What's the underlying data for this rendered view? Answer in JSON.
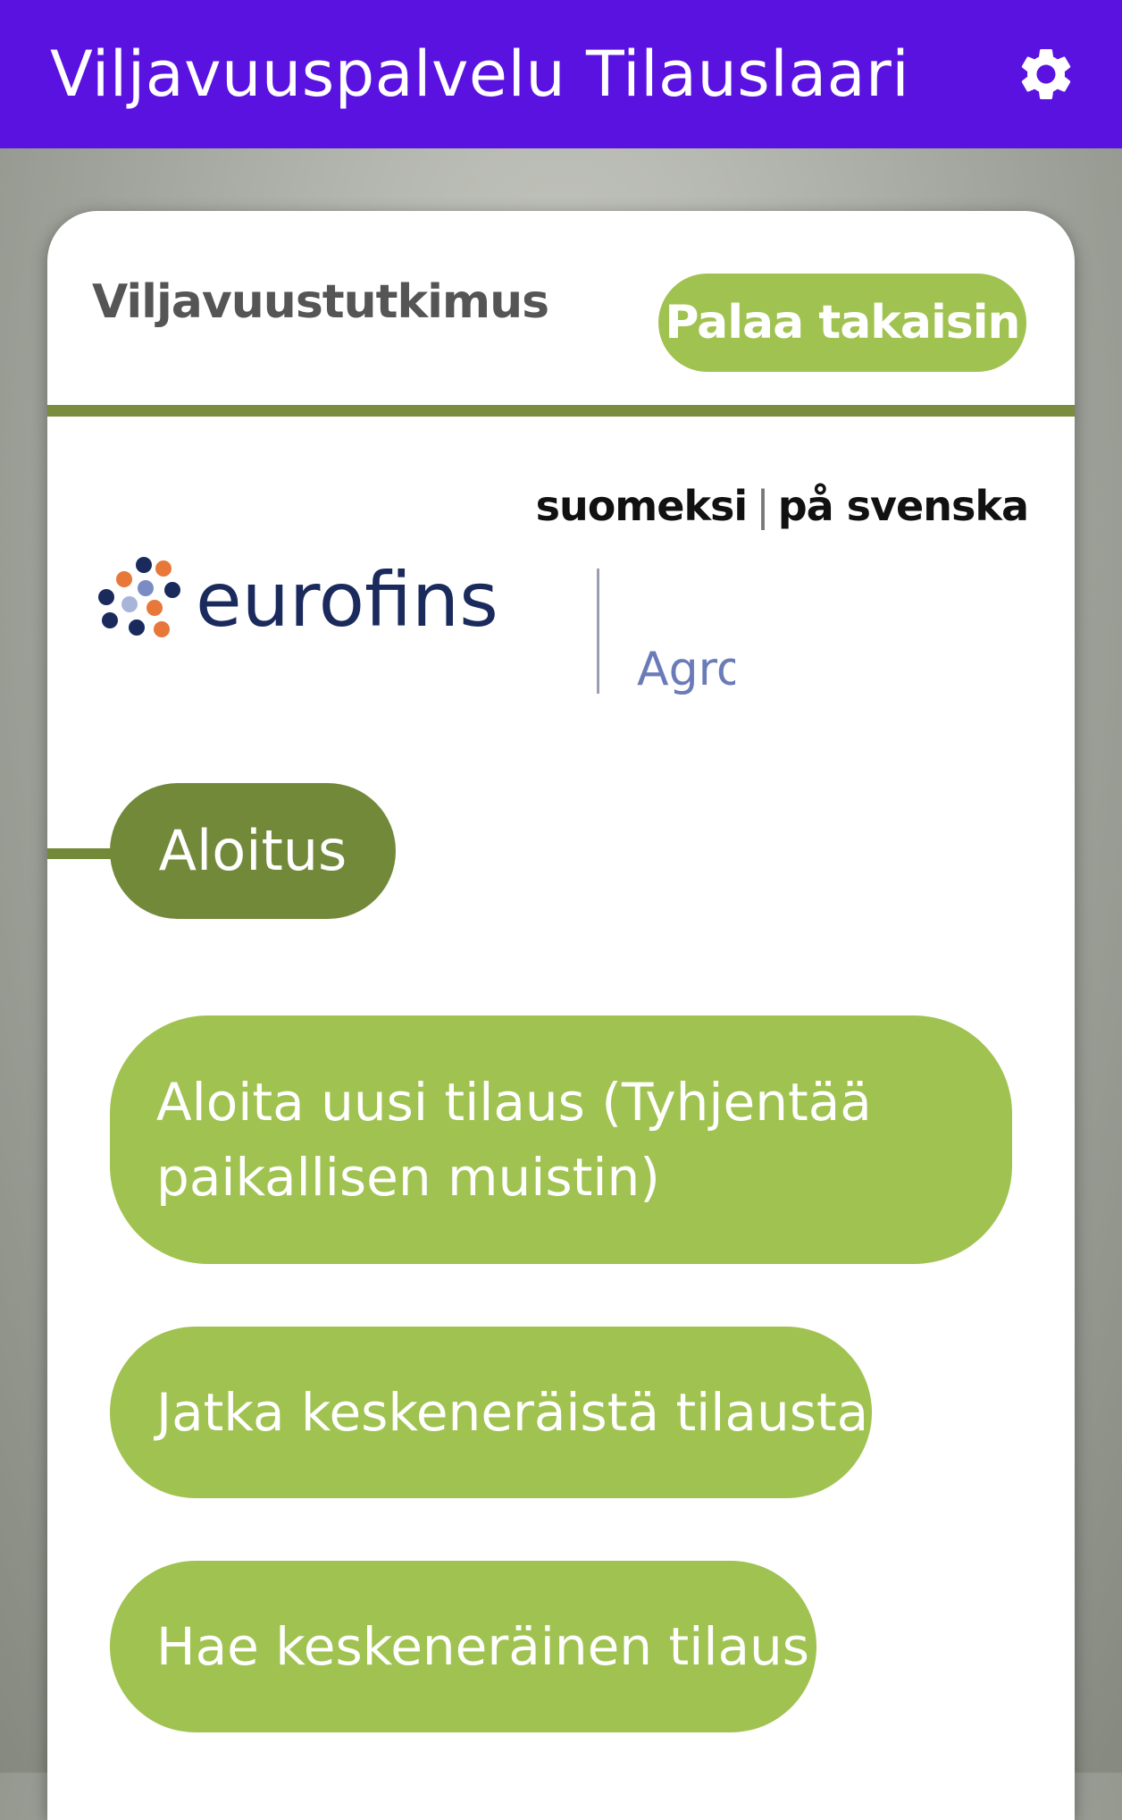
{
  "appbar": {
    "title": "Viljavuuspalvelu Tilauslaari",
    "settings_icon": "gear-icon"
  },
  "card": {
    "title": "Viljavuustutkimus",
    "back_label": "Palaa takaisin"
  },
  "language": {
    "finnish": "suomeksi",
    "separator": "|",
    "swedish": "på svenska"
  },
  "logo": {
    "brand": "eurofins",
    "division": "Agro"
  },
  "step": {
    "label": "Aloitus"
  },
  "actions": [
    {
      "label": "Aloita uusi tilaus (Tyhjentää paikallisen muistin)"
    },
    {
      "label": "Jatka keskeneräistä tilausta"
    },
    {
      "label": "Hae keskeneräinen tilaus"
    }
  ],
  "colors": {
    "appbar": "#5a12e0",
    "accent_green": "#a0c250",
    "dark_green": "#72893a",
    "divider_green": "#7a8c3e",
    "logo_navy": "#1b2a5c",
    "logo_orange": "#e8773a"
  }
}
